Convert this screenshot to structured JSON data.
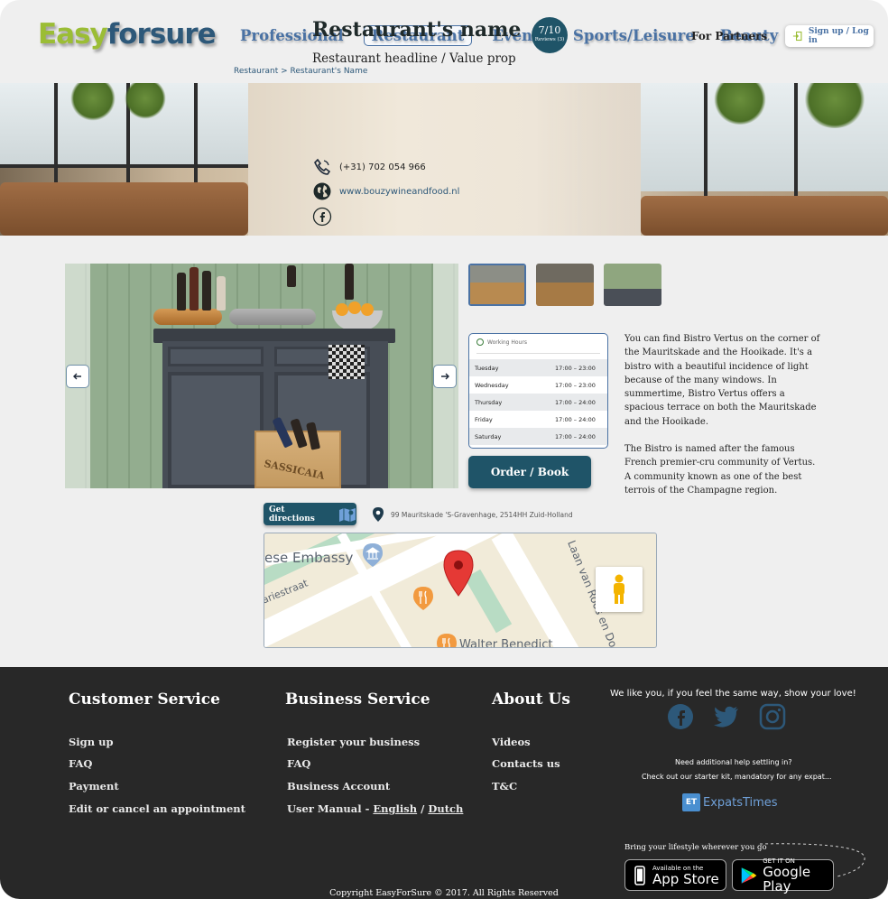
{
  "header": {
    "logo_easy": "Easy",
    "logo_forsure": "forsure",
    "nav": [
      "Professional",
      "Restaurant",
      "Events",
      "Sports/Leisure",
      "Beauty"
    ],
    "active_nav": "Restaurant",
    "partners_label": "For Partners",
    "signup_label": "Sign up / Log in"
  },
  "breadcrumb": "Restaurant > Restaurant's Name",
  "hero": {
    "name": "Restaurant's name",
    "headline": "Restaurant headline / Value prop",
    "rating_score": "7/10",
    "rating_reviews": "Reviews (3)",
    "phone": "(+31) 702 054 966",
    "website": "www.bouzywineandfood.nl"
  },
  "gallery": {
    "crate_label": "SASSICAIA",
    "prev_icon": "arrow-left-icon",
    "next_icon": "arrow-right-icon",
    "thumbnails": 3
  },
  "working_hours": {
    "title": "Working Hours",
    "rows": [
      {
        "day": "Tuesday",
        "time": "17:00 – 23:00"
      },
      {
        "day": "Wednesday",
        "time": "17:00 – 23:00"
      },
      {
        "day": "Thursday",
        "time": "17:00 – 24:00"
      },
      {
        "day": "Friday",
        "time": "17:00 – 24:00"
      },
      {
        "day": "Saturday",
        "time": "17:00 – 24:00"
      }
    ]
  },
  "order_label": "Order / Book",
  "description": {
    "p1": "You can find Bistro Vertus on the corner of the Mauritskade and the Hooikade. It's a bistro with a beautiful incidence of light because of the many windows.  In summertime, Bistro Vertus offers a spacious terrace on both the Mauritskade and the Hooikade.",
    "p2": "The Bistro is named after the famous French premier-cru community of Vertus.",
    "p3": "A community known as one of the best terrois of the Champagne region."
  },
  "directions_label": "Get directions",
  "address": "99 Mauritskade 'S-Gravenhage, 2514HH Zuid-Holland",
  "map": {
    "labels": [
      "ese Embassy",
      "ariestraat",
      "Laan van Roos en Do",
      "Walter Benedict"
    ]
  },
  "footer": {
    "customer_service": {
      "title": "Customer Service",
      "links": [
        "Sign up",
        "FAQ",
        "Payment",
        "Edit or cancel an appointment"
      ]
    },
    "business_service": {
      "title": "Business Service",
      "links": [
        "Register your business",
        "FAQ",
        "Business Account"
      ],
      "manual_prefix": "User Manual - ",
      "manual_english": "English",
      "manual_sep": " / ",
      "manual_dutch": "Dutch"
    },
    "about": {
      "title": "About Us",
      "links": [
        "Videos",
        "Contacts us",
        "T&C"
      ]
    },
    "love_text": "We like you, if you feel the same way, show your love!",
    "social_icons": [
      "facebook-icon",
      "twitter-icon",
      "instagram-icon"
    ],
    "help_line1": "Need additional help settling in?",
    "help_line2": "Check out our starter kit, mandatory for any expat...",
    "expats_badge": "ET",
    "expats_name": "ExpatsTimes",
    "bring_text": "Bring your lifestyle wherever you go",
    "appstore_small": "Available on the",
    "appstore_big": "App Store",
    "googleplay_small": "GET IT ON",
    "googleplay_big": "Google Play",
    "copyright": "Copyright EasyForSure © 2017. All Rights Reserved"
  }
}
